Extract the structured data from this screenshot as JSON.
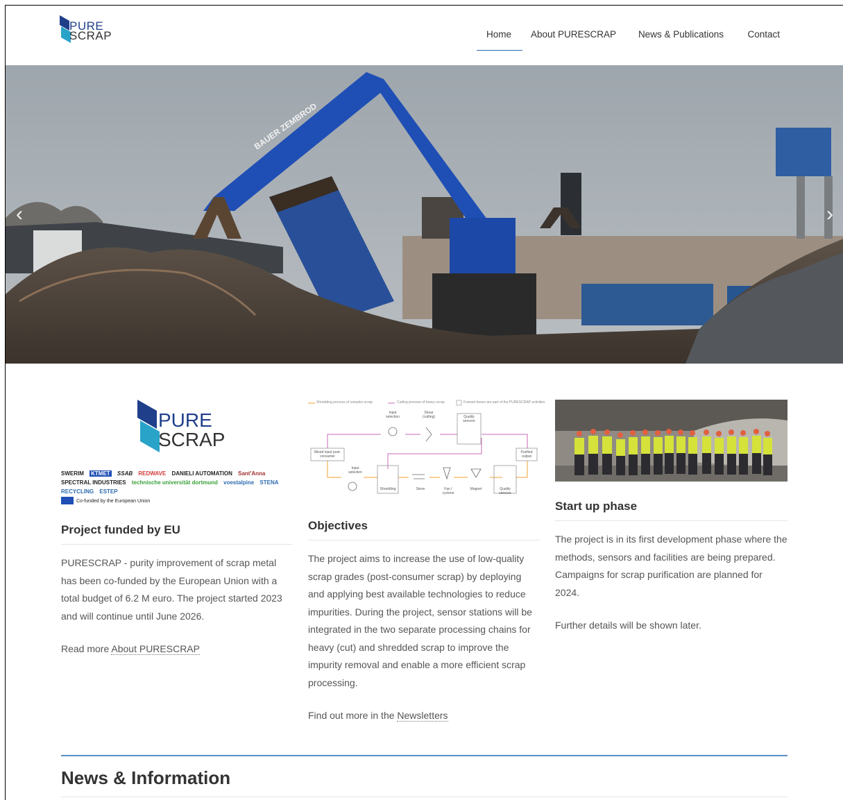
{
  "header": {
    "logo_top": "PURE",
    "logo_bottom": "SCRAP",
    "nav": [
      {
        "label": "Home",
        "active": true
      },
      {
        "label": "About PURESCRAP",
        "active": false
      },
      {
        "label": "News & Publications",
        "active": false
      },
      {
        "label": "Contact",
        "active": false
      }
    ]
  },
  "hero": {
    "crane_text": "BAUER ZEMBROD",
    "prev_icon": "chevron-left-icon",
    "next_icon": "chevron-right-icon"
  },
  "columns": [
    {
      "big_logo_top": "PURE",
      "big_logo_bottom": "SCRAP",
      "partners": [
        "SWERIM",
        "KTMET",
        "SSAB",
        "REDWAVE",
        "DANIELI AUTOMATION",
        "Sant'Anna",
        "SPECTRAL INDUSTRIES",
        "technische universität dortmund",
        "voestalpine",
        "STENA RECYCLING",
        "ESTEP"
      ],
      "eu_text": "Co-funded by the European Union",
      "title": "Project funded by EU",
      "paragraphs": [
        "PURESCRAP - purity improvement of scrap metal has been co-funded by the European Union with a total budget of 6.2 M euro. The project started 2023 and will continue until June 2026."
      ],
      "more_prefix": "Read more ",
      "more_link": "About PURESCRAP"
    },
    {
      "diagram": {
        "legend": [
          "Shredding process of complex scrap",
          "Cutting process of heavy scrap",
          "Framed boxes are part of the PURESCRAP activities"
        ],
        "top_nodes": [
          "Input selection",
          "Shear (cutting)",
          "Quality sensors"
        ],
        "left_node": "Mixed input post-consumer",
        "right_node": "Purified output",
        "bottom_nodes": [
          "Input selection",
          "Shredding",
          "Sieve",
          "Fan / cyclone",
          "Magnet",
          "Quality sensors"
        ]
      },
      "title": "Objectives",
      "paragraphs": [
        "The project aims to increase the use of low-quality scrap grades (post-consumer scrap) by deploying and applying best available technologies to reduce impurities. During the project, sensor stations will be integrated in the two separate processing chains for heavy (cut) and shredded scrap to improve the impurity removal and enable a more efficient scrap processing."
      ],
      "more_prefix": "Find out more in the ",
      "more_link": "Newsletters"
    },
    {
      "title": "Start up phase",
      "paragraphs": [
        "The project is in its first development phase where the methods, sensors and facilities are being prepared. Campaigns for scrap purification are planned for 2024.",
        "Further details will be shown later."
      ]
    }
  ],
  "news": {
    "title": "News & Information"
  },
  "colors": {
    "accent_blue": "#2d6bb0",
    "logo_dark": "#1f3f8a",
    "logo_teal": "#2aa3c9",
    "crane_blue": "#1f4fb5"
  }
}
